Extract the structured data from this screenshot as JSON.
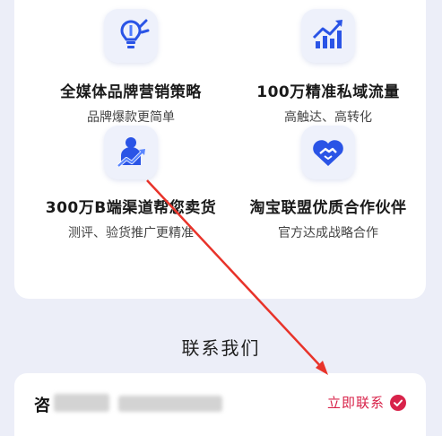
{
  "features": [
    {
      "title": "全媒体品牌营销策略",
      "subtitle": "品牌爆款更简单",
      "icon": "lightbulb-icon"
    },
    {
      "title": "100万精准私域流量",
      "subtitle": "高触达、高转化",
      "icon": "growth-chart-icon"
    },
    {
      "title": "300万B端渠道帮您卖货",
      "subtitle": "测评、验货推广更精准",
      "icon": "sales-person-icon"
    },
    {
      "title": "淘宝联盟优质合作伙伴",
      "subtitle": "官方达成战略合作",
      "icon": "handshake-heart-icon"
    }
  ],
  "contact_section": {
    "title": "联系我们",
    "consult_label": "咨",
    "contact_link": "立即联系"
  },
  "colors": {
    "accent": "#d8234a",
    "icon_blue": "#2a54e6",
    "annotation_arrow": "#e8332a"
  }
}
